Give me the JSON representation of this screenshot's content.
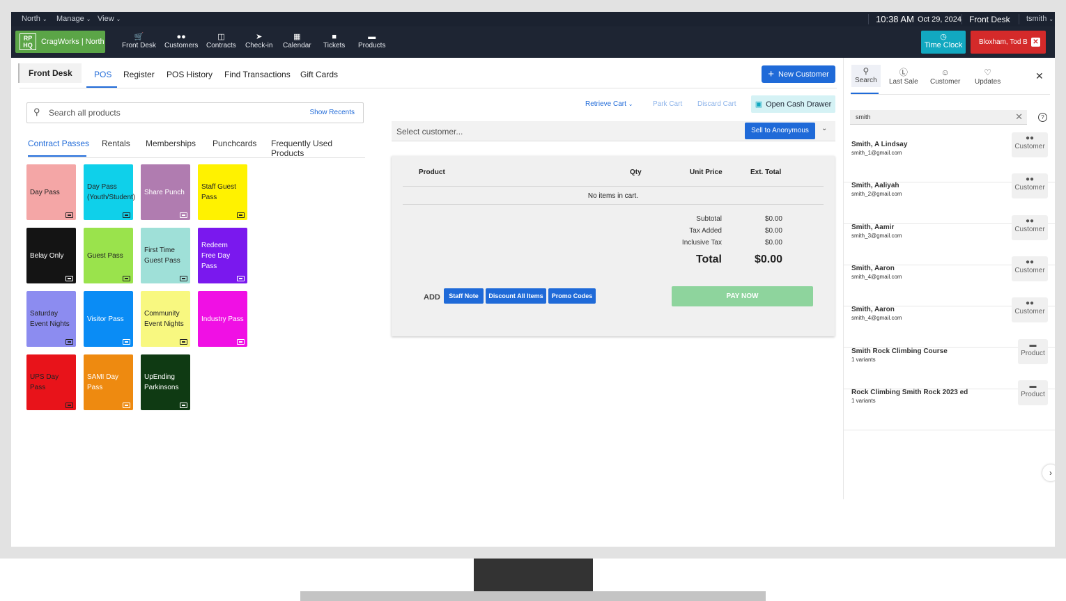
{
  "topbar": {
    "menus": [
      {
        "label": "North"
      },
      {
        "label": "Manage"
      },
      {
        "label": "View"
      }
    ],
    "time": "10:38 AM",
    "date": "Oct 29, 2024",
    "location": "Front Desk",
    "user": "tsmith"
  },
  "navbar": {
    "brand_logo": "RP HQ",
    "brand_name": "CragWorks | North",
    "items": [
      {
        "label": "Front Desk",
        "icon": "cart-icon"
      },
      {
        "label": "Customers",
        "icon": "users-icon"
      },
      {
        "label": "Contracts",
        "icon": "document-icon"
      },
      {
        "label": "Check-in",
        "icon": "arrow-circle-icon"
      },
      {
        "label": "Calendar",
        "icon": "calendar-icon"
      },
      {
        "label": "Tickets",
        "icon": "chat-icon"
      },
      {
        "label": "Products",
        "icon": "products-icon"
      }
    ],
    "time_clock": "Time Clock",
    "current_customer": "Bloxham, Tod B"
  },
  "subnav": {
    "section": "Front Desk",
    "tabs": [
      "POS",
      "Register",
      "POS History",
      "Find Transactions",
      "Gift Cards"
    ],
    "active_tab": "POS",
    "new_customer": "New Customer"
  },
  "products": {
    "search_placeholder": "Search all products",
    "show_recents": "Show Recents",
    "tabs": [
      "Contract Passes",
      "Rentals",
      "Memberships",
      "Punchcards",
      "Frequently Used Products"
    ],
    "active_tab": "Contract Passes",
    "tiles": [
      {
        "label": "Day Pass",
        "color": "#f4a6a6",
        "text": "#222222"
      },
      {
        "label": "Day Pass (Youth/Student)",
        "color": "#0fd0ea",
        "text": "#222222"
      },
      {
        "label": "Share Punch",
        "color": "#b07cb0",
        "text": "#ffffff"
      },
      {
        "label": "Staff Guest Pass",
        "color": "#fff200",
        "text": "#222222"
      },
      {
        "label": "Belay Only",
        "color": "#141414",
        "text": "#ffffff"
      },
      {
        "label": "Guest Pass",
        "color": "#9ae34c",
        "text": "#222222"
      },
      {
        "label": "First Time Guest Pass",
        "color": "#9fe0d8",
        "text": "#222222"
      },
      {
        "label": "Redeem Free Day Pass",
        "color": "#7a18ee",
        "text": "#ffffff"
      },
      {
        "label": "Saturday Event Nights",
        "color": "#8c8cf0",
        "text": "#222222"
      },
      {
        "label": "Visitor Pass",
        "color": "#0a8cf5",
        "text": "#ffffff"
      },
      {
        "label": "Community Event Nights",
        "color": "#f8f880",
        "text": "#222222"
      },
      {
        "label": "Industry Pass",
        "color": "#f010e4",
        "text": "#ffffff"
      },
      {
        "label": "UPS Day Pass",
        "color": "#e8131a",
        "text": "#222222"
      },
      {
        "label": "SAMI Day Pass",
        "color": "#ee8a10",
        "text": "#ffffff"
      },
      {
        "label": "UpEnding Parkinsons",
        "color": "#0f3a13",
        "text": "#ffffff"
      }
    ]
  },
  "cart": {
    "retrieve_cart": "Retrieve Cart",
    "park_cart": "Park Cart",
    "discard_cart": "Discard Cart",
    "open_cash_drawer": "Open Cash Drawer",
    "customer_placeholder": "Select customer...",
    "sell_anonymous": "Sell to Anonymous",
    "columns": {
      "product": "Product",
      "qty": "Qty",
      "unit_price": "Unit Price",
      "ext_total": "Ext. Total"
    },
    "empty_message": "No items in cart.",
    "subtotal_label": "Subtotal",
    "subtotal": "$0.00",
    "tax_added_label": "Tax Added",
    "tax_added": "$0.00",
    "inclusive_tax_label": "Inclusive Tax",
    "inclusive_tax": "$0.00",
    "total_label": "Total",
    "total": "$0.00",
    "add_label": "ADD",
    "staff_note": "Staff Note",
    "discount_all": "Discount All Items",
    "promo_codes": "Promo Codes",
    "pay_now": "PAY NOW"
  },
  "rightpanel": {
    "tabs": [
      {
        "label": "Search",
        "icon": "search-icon"
      },
      {
        "label": "Last Sale",
        "icon": "dollar-icon"
      },
      {
        "label": "Customer",
        "icon": "person-icon"
      },
      {
        "label": "Updates",
        "icon": "bell-icon"
      }
    ],
    "active_tab": "Search",
    "search_value": "smith",
    "results": [
      {
        "name": "Smith, A Lindsay",
        "sub": "smith_1@gmail.com",
        "kind": "Customer"
      },
      {
        "name": "Smith, Aaliyah",
        "sub": "smith_2@gmail.com",
        "kind": "Customer"
      },
      {
        "name": "Smith, Aamir",
        "sub": "smith_3@gmail.com",
        "kind": "Customer"
      },
      {
        "name": "Smith, Aaron",
        "sub": "smith_4@gmail.com",
        "kind": "Customer"
      },
      {
        "name": "Smith, Aaron",
        "sub": "smith_4@gmail.com",
        "kind": "Customer"
      },
      {
        "name": "Smith Rock Climbing Course",
        "sub": "1 variants",
        "kind": "Product"
      },
      {
        "name": "Rock Climbing Smith Rock 2023 ed",
        "sub": "1 variants",
        "kind": "Product"
      }
    ]
  }
}
